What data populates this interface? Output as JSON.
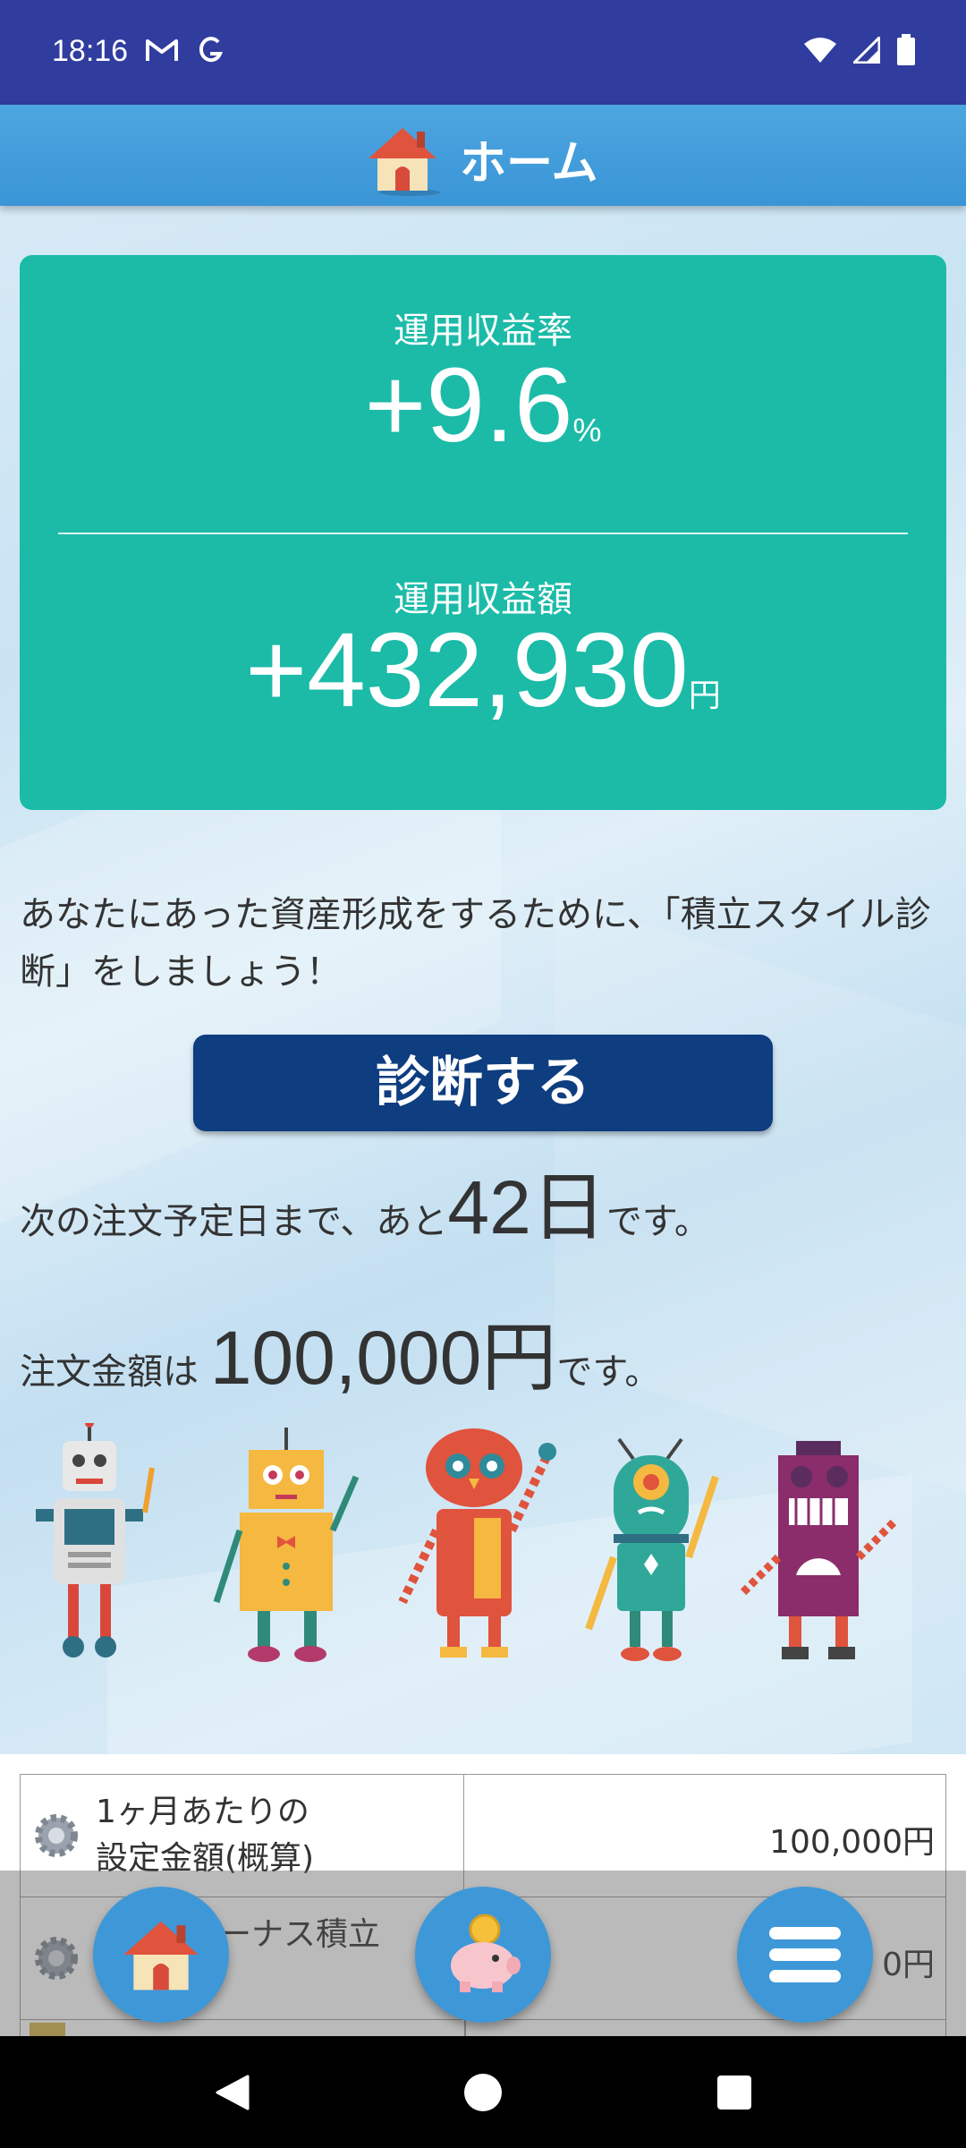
{
  "status_bar": {
    "time": "18:16"
  },
  "app_bar": {
    "title": "ホーム"
  },
  "card": {
    "rate_label": "運用収益率",
    "rate_value": "+9.6",
    "rate_unit": "%",
    "amount_label": "運用収益額",
    "amount_value": "+432,930",
    "amount_unit": "円"
  },
  "intro_text": "あなたにあった資産形成をするために、「積立スタイル診断」をしましょう！",
  "diagnose_button": "診断する",
  "next_order": {
    "prefix": "次の注文予定日まで、あと",
    "days": "42日",
    "suffix": "です。"
  },
  "order_amount": {
    "prefix": "注文金額は",
    "amount": "100,000円",
    "suffix": "です。"
  },
  "table": {
    "rows": [
      {
        "label_line1": "1ヶ月あたりの",
        "label_line2": "設定金額(概算)",
        "value": "100,000円"
      },
      {
        "label_line1": "ボーナス積立",
        "value": "0円"
      }
    ]
  },
  "colors": {
    "status_bar": "#303d9e",
    "app_bar": "#3a95d6",
    "card": "#1bbba8",
    "button": "#0e3d80",
    "fab": "#3e98d8"
  },
  "icons": [
    "gmail-icon",
    "g-icon",
    "wifi-icon",
    "signal-icon",
    "battery-icon",
    "home-icon",
    "piggy-bank-icon",
    "menu-icon",
    "gear-icon",
    "back-icon",
    "home-nav-icon",
    "recents-icon"
  ]
}
